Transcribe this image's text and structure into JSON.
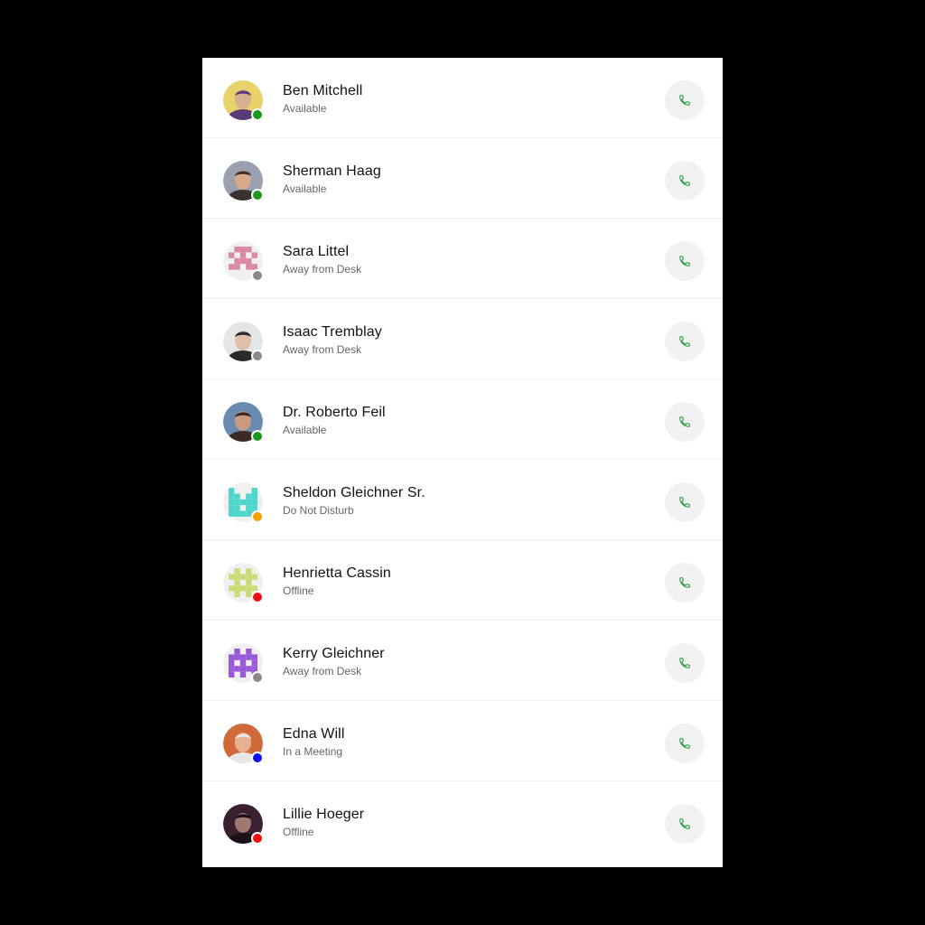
{
  "colors": {
    "available": "#1a9a1a",
    "away": "#8a8a8a",
    "dnd": "#f5a100",
    "offline": "#ee1111",
    "meeting": "#1111ee",
    "call_icon": "#1f9a3a",
    "call_bg": "#f2f2f2"
  },
  "contacts": [
    {
      "name": "Ben Mitchell",
      "status": "Available",
      "status_key": "available",
      "avatar": "photo",
      "avatar_colors": [
        "#e8d36a",
        "#5b3a7a",
        "#d9b08c"
      ]
    },
    {
      "name": "Sherman Haag",
      "status": "Available",
      "status_key": "available",
      "avatar": "photo",
      "avatar_colors": [
        "#9aa0b0",
        "#3a3030",
        "#d8a888"
      ]
    },
    {
      "name": "Sara Littel",
      "status": "Away from Desk",
      "status_key": "away",
      "avatar": "identicon",
      "avatar_colors": [
        "#d98aa0",
        "#f0f0f0"
      ]
    },
    {
      "name": "Isaac Tremblay",
      "status": "Away from Desk",
      "status_key": "away",
      "avatar": "photo",
      "avatar_colors": [
        "#e6e6e6",
        "#2a2a2a",
        "#e0bfa8"
      ]
    },
    {
      "name": "Dr. Roberto Feil",
      "status": "Available",
      "status_key": "available",
      "avatar": "photo",
      "avatar_colors": [
        "#6a8ab0",
        "#3a2a24",
        "#c89a80"
      ]
    },
    {
      "name": "Sheldon Gleichner Sr.",
      "status": "Do Not Disturb",
      "status_key": "dnd",
      "avatar": "identicon",
      "avatar_colors": [
        "#4fd6cc",
        "#f0f0f0"
      ]
    },
    {
      "name": "Henrietta Cassin",
      "status": "Offline",
      "status_key": "offline",
      "avatar": "identicon",
      "avatar_colors": [
        "#c8dc78",
        "#f0f0f0"
      ]
    },
    {
      "name": "Kerry Gleichner",
      "status": "Away from Desk",
      "status_key": "away",
      "avatar": "identicon",
      "avatar_colors": [
        "#9a5ad8",
        "#f0f0f0"
      ]
    },
    {
      "name": "Edna Will",
      "status": "In a Meeting",
      "status_key": "meeting",
      "avatar": "photo",
      "avatar_colors": [
        "#d06a3a",
        "#e8e8e8",
        "#e8b090"
      ]
    },
    {
      "name": "Lillie Hoeger",
      "status": "Offline",
      "status_key": "offline",
      "avatar": "photo",
      "avatar_colors": [
        "#3a2030",
        "#1a1018",
        "#a07870"
      ]
    }
  ],
  "call_icon_name": "phone-icon"
}
